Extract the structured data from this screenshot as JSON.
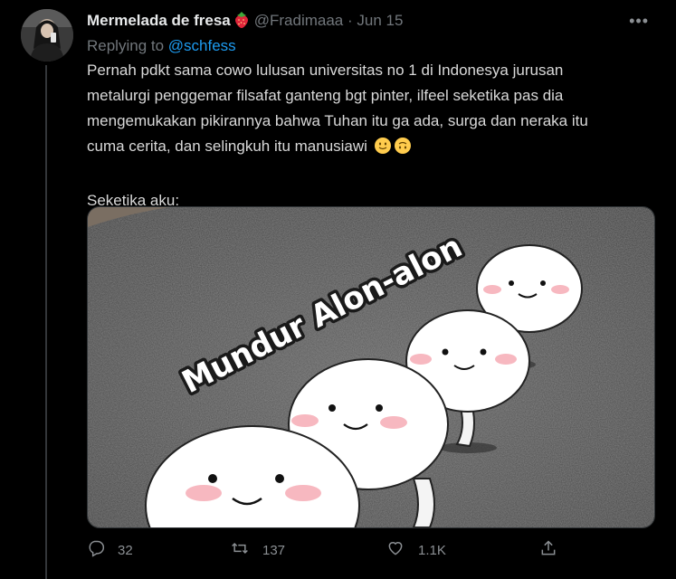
{
  "author": {
    "display_name": "Mermelada de fresa",
    "name_emoji_icon": "strawberry-icon",
    "handle": "@Fradimaaa",
    "separator": "·",
    "date": "Jun 15"
  },
  "reply": {
    "prefix": "Replying to",
    "to": "@schfess"
  },
  "tweet": {
    "line1": "Pernah pdkt sama cowo lulusan universitas no 1 di Indonesya jurusan",
    "line2": "metalurgi penggemar filsafat ganteng bgt pinter, ilfeel seketika pas dia",
    "line3": "mengemukakan pikirannya bahwa Tuhan itu ga ada, surga dan neraka itu",
    "line4": "cuma cerita, dan selingkuh itu manusiawi",
    "emojis": [
      "slightly-smiling-face-icon",
      "upside-down-face-icon"
    ],
    "line5": "Seketika aku:"
  },
  "media": {
    "caption": "Mundur Alon-alon"
  },
  "actions": {
    "replies": "32",
    "retweets": "137",
    "likes": "1.1K"
  },
  "colors": {
    "background": "#000000",
    "text": "#d9d9d9",
    "muted": "#71767b",
    "link": "#1d9bf0"
  }
}
